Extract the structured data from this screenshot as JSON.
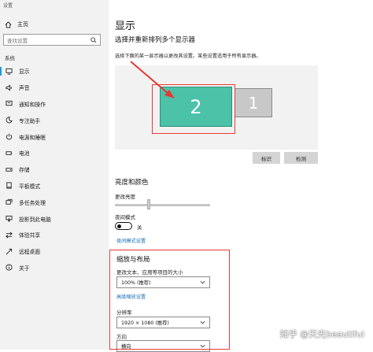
{
  "window": {
    "title": "设置"
  },
  "sidebar": {
    "home_label": "主页",
    "search_placeholder": "查找设置",
    "section_label": "系统",
    "items": [
      {
        "label": "显示",
        "icon": "monitor-icon",
        "active": true
      },
      {
        "label": "声音",
        "icon": "speaker-icon"
      },
      {
        "label": "通知和操作",
        "icon": "notification-icon"
      },
      {
        "label": "专注助手",
        "icon": "moon-icon"
      },
      {
        "label": "电源和睡眠",
        "icon": "power-icon"
      },
      {
        "label": "电池",
        "icon": "battery-icon"
      },
      {
        "label": "存储",
        "icon": "storage-icon"
      },
      {
        "label": "平板模式",
        "icon": "tablet-icon"
      },
      {
        "label": "多任务处理",
        "icon": "multitask-icon"
      },
      {
        "label": "投影到此电脑",
        "icon": "project-icon"
      },
      {
        "label": "体验共享",
        "icon": "share-icon"
      },
      {
        "label": "远程桌面",
        "icon": "remote-icon"
      },
      {
        "label": "关于",
        "icon": "info-icon"
      }
    ]
  },
  "main": {
    "page_title": "显示",
    "arrange_title": "选择并重新排列多个显示器",
    "arrange_desc": "选择下面的某一显示器以更改其设置。某些设置适用于所有显示器。",
    "monitors": [
      {
        "number": "2",
        "selected": true
      },
      {
        "number": "1",
        "selected": false
      }
    ],
    "identify_button": "标识",
    "detect_button": "检测",
    "brightness_title": "亮度和颜色",
    "brightness_label": "更改亮度",
    "night_light_label": "夜间模式",
    "night_light_state": "关",
    "night_light_link": "夜间模式设置",
    "scale_title": "缩放与布局",
    "scale_label": "更改文本、应用等项目的大小",
    "scale_value": "100% (推荐)",
    "advanced_scale_link": "高级缩放设置",
    "resolution_label": "分辨率",
    "resolution_value": "1920 × 1080 (推荐)",
    "orientation_label": "方向",
    "orientation_value": "横向"
  },
  "watermark": "知乎 @天光beautiful",
  "colors": {
    "accent": "#1e9bd7",
    "highlight_red": "#e53935",
    "selected_monitor": "#4cc2a8",
    "link": "#1a6fb5"
  }
}
